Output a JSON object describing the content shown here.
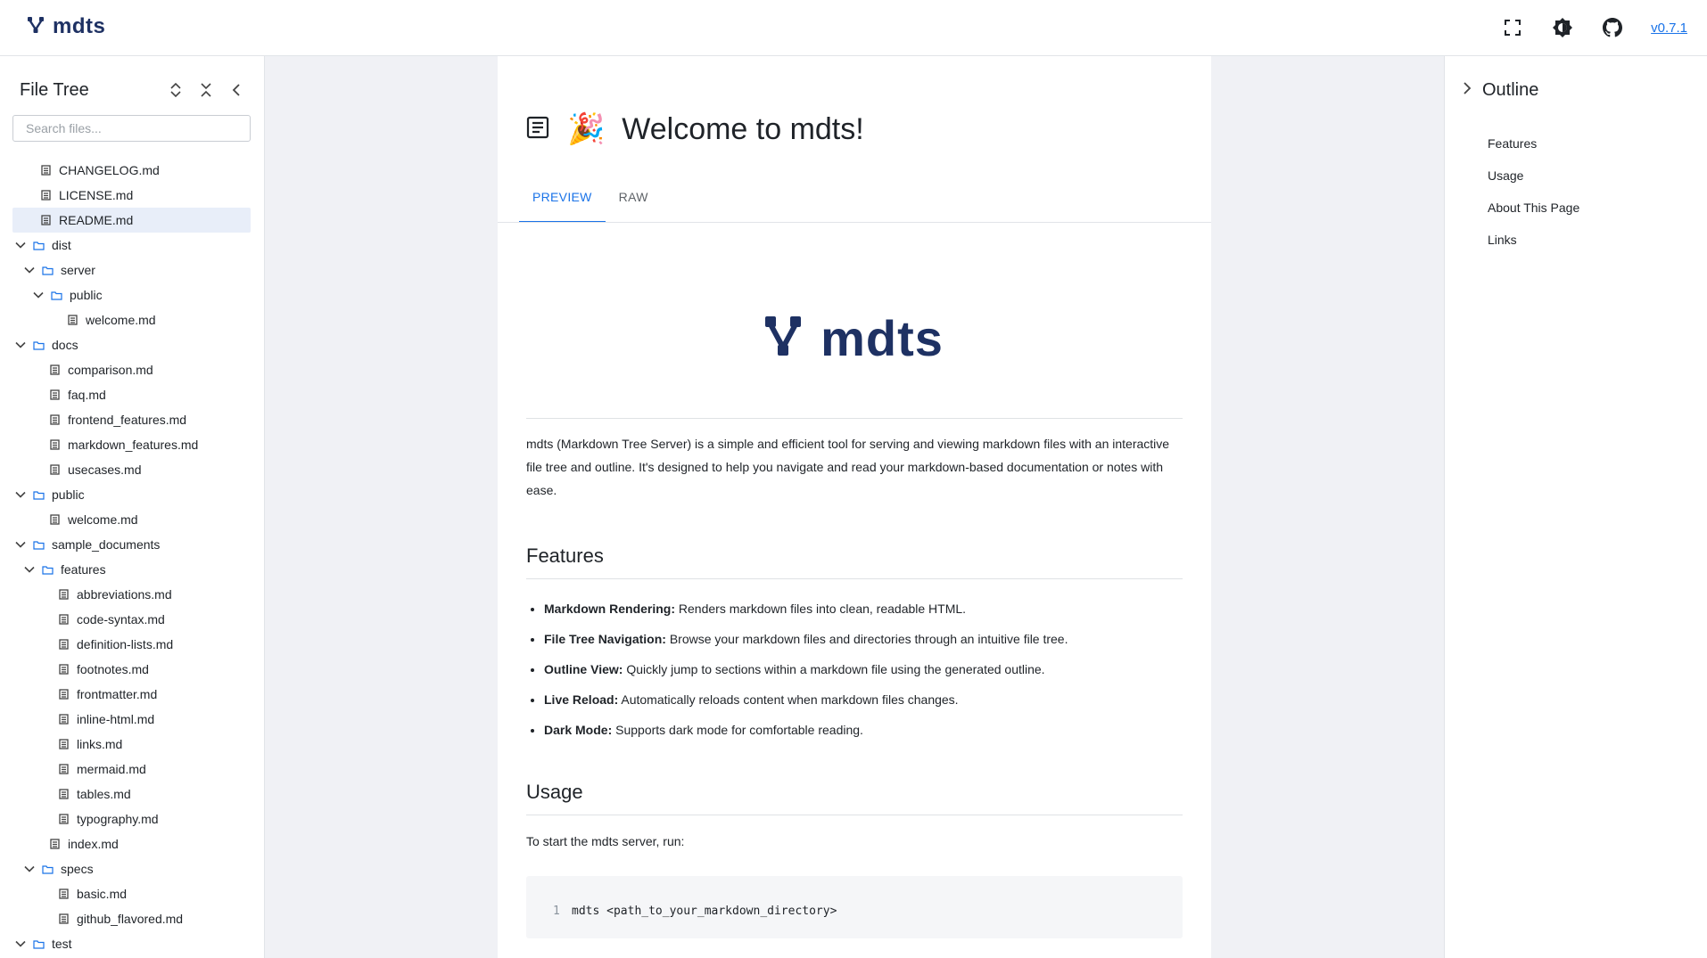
{
  "header": {
    "app_name": "mdts",
    "version": "v0.7.1",
    "icons": [
      "fullscreen-icon",
      "theme-toggle-icon",
      "github-icon"
    ]
  },
  "sidebar": {
    "title": "File Tree",
    "search_placeholder": "Search files...",
    "tree": [
      {
        "label": "CHANGELOG.md",
        "type": "file",
        "depth": 0
      },
      {
        "label": "LICENSE.md",
        "type": "file",
        "depth": 0
      },
      {
        "label": "README.md",
        "type": "file",
        "depth": 0,
        "selected": true
      },
      {
        "label": "dist",
        "type": "folder",
        "depth": 0
      },
      {
        "label": "server",
        "type": "folder",
        "depth": 1
      },
      {
        "label": "public",
        "type": "folder",
        "depth": 2
      },
      {
        "label": "welcome.md",
        "type": "file",
        "depth": 3
      },
      {
        "label": "docs",
        "type": "folder",
        "depth": 0
      },
      {
        "label": "comparison.md",
        "type": "file",
        "depth": 1
      },
      {
        "label": "faq.md",
        "type": "file",
        "depth": 1
      },
      {
        "label": "frontend_features.md",
        "type": "file",
        "depth": 1
      },
      {
        "label": "markdown_features.md",
        "type": "file",
        "depth": 1
      },
      {
        "label": "usecases.md",
        "type": "file",
        "depth": 1
      },
      {
        "label": "public",
        "type": "folder",
        "depth": 0
      },
      {
        "label": "welcome.md",
        "type": "file",
        "depth": 1
      },
      {
        "label": "sample_documents",
        "type": "folder",
        "depth": 0
      },
      {
        "label": "features",
        "type": "folder",
        "depth": 1
      },
      {
        "label": "abbreviations.md",
        "type": "file",
        "depth": 2
      },
      {
        "label": "code-syntax.md",
        "type": "file",
        "depth": 2
      },
      {
        "label": "definition-lists.md",
        "type": "file",
        "depth": 2
      },
      {
        "label": "footnotes.md",
        "type": "file",
        "depth": 2
      },
      {
        "label": "frontmatter.md",
        "type": "file",
        "depth": 2
      },
      {
        "label": "inline-html.md",
        "type": "file",
        "depth": 2
      },
      {
        "label": "links.md",
        "type": "file",
        "depth": 2
      },
      {
        "label": "mermaid.md",
        "type": "file",
        "depth": 2
      },
      {
        "label": "tables.md",
        "type": "file",
        "depth": 2
      },
      {
        "label": "typography.md",
        "type": "file",
        "depth": 2
      },
      {
        "label": "index.md",
        "type": "file",
        "depth": 1
      },
      {
        "label": "specs",
        "type": "folder",
        "depth": 1
      },
      {
        "label": "basic.md",
        "type": "file",
        "depth": 2
      },
      {
        "label": "github_flavored.md",
        "type": "file",
        "depth": 2
      },
      {
        "label": "test",
        "type": "folder",
        "depth": 0
      }
    ]
  },
  "document": {
    "title": "Welcome to mdts!",
    "emoji": "🎉",
    "tabs": [
      {
        "label": "PREVIEW",
        "active": true
      },
      {
        "label": "RAW",
        "active": false
      }
    ],
    "hero_text": "mdts",
    "intro": "mdts (Markdown Tree Server) is a simple and efficient tool for serving and viewing markdown files with an interactive file tree and outline. It's designed to help you navigate and read your markdown-based documentation or notes with ease.",
    "features_heading": "Features",
    "features": [
      {
        "name": "Markdown Rendering:",
        "desc": " Renders markdown files into clean, readable HTML."
      },
      {
        "name": "File Tree Navigation:",
        "desc": " Browse your markdown files and directories through an intuitive file tree."
      },
      {
        "name": "Outline View:",
        "desc": " Quickly jump to sections within a markdown file using the generated outline."
      },
      {
        "name": "Live Reload:",
        "desc": " Automatically reloads content when markdown files changes."
      },
      {
        "name": "Dark Mode:",
        "desc": " Supports dark mode for comfortable reading."
      }
    ],
    "usage_heading": "Usage",
    "usage_text": "To start the mdts server, run:",
    "code": {
      "line_number": "1",
      "command": "mdts <path_to_your_markdown_directory>"
    }
  },
  "outline": {
    "title": "Outline",
    "items": [
      "Features",
      "Usage",
      "About This Page",
      "Links"
    ]
  },
  "colors": {
    "brand": "#1e3163",
    "accent": "#1a73e8",
    "selected_bg": "#e8eef9",
    "page_bg": "#f0f1f5"
  }
}
